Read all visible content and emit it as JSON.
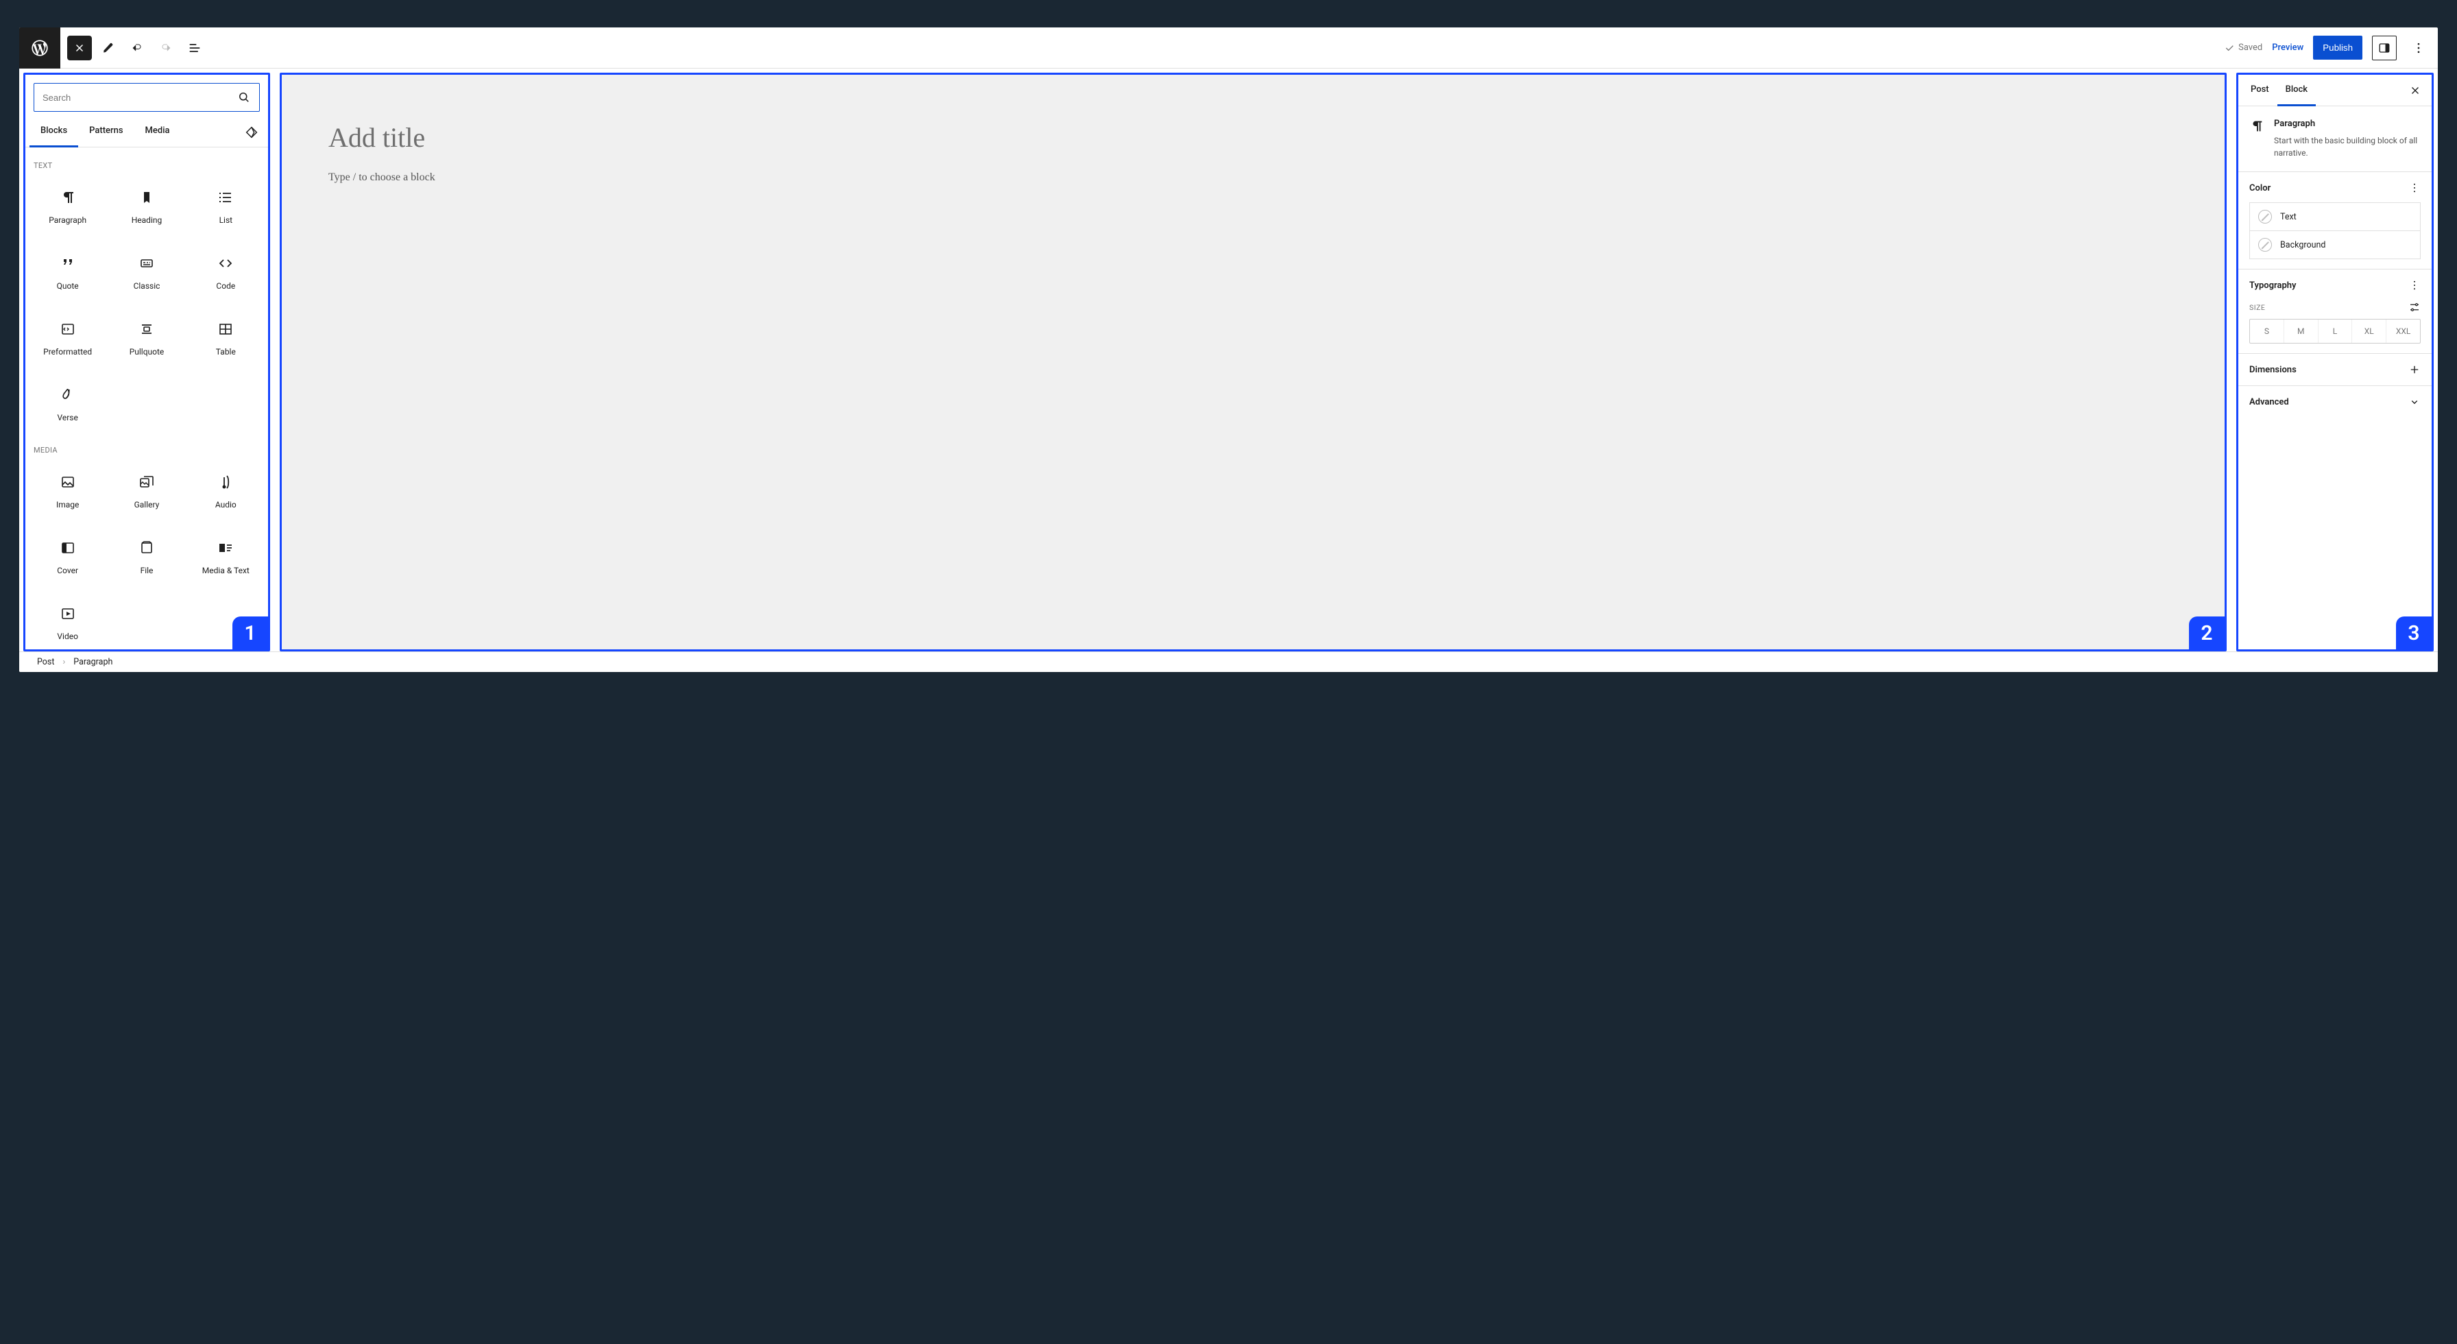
{
  "topbar": {
    "saved": "Saved",
    "preview": "Preview",
    "publish": "Publish"
  },
  "inserter": {
    "search_placeholder": "Search",
    "tabs": {
      "blocks": "Blocks",
      "patterns": "Patterns",
      "media": "Media"
    },
    "categories": [
      {
        "title": "TEXT",
        "blocks": [
          {
            "label": "Paragraph",
            "icon": "paragraph"
          },
          {
            "label": "Heading",
            "icon": "heading"
          },
          {
            "label": "List",
            "icon": "list"
          },
          {
            "label": "Quote",
            "icon": "quote"
          },
          {
            "label": "Classic",
            "icon": "classic"
          },
          {
            "label": "Code",
            "icon": "code"
          },
          {
            "label": "Preformatted",
            "icon": "preformatted"
          },
          {
            "label": "Pullquote",
            "icon": "pullquote"
          },
          {
            "label": "Table",
            "icon": "table"
          },
          {
            "label": "Verse",
            "icon": "verse"
          }
        ]
      },
      {
        "title": "MEDIA",
        "blocks": [
          {
            "label": "Image",
            "icon": "image"
          },
          {
            "label": "Gallery",
            "icon": "gallery"
          },
          {
            "label": "Audio",
            "icon": "audio"
          },
          {
            "label": "Cover",
            "icon": "cover"
          },
          {
            "label": "File",
            "icon": "file"
          },
          {
            "label": "Media & Text",
            "icon": "mediatext"
          },
          {
            "label": "Video",
            "icon": "video"
          }
        ]
      }
    ]
  },
  "canvas": {
    "title_placeholder": "Add title",
    "body_placeholder": "Type / to choose a block"
  },
  "settings": {
    "tabs": {
      "post": "Post",
      "block": "Block"
    },
    "block_title": "Paragraph",
    "block_desc": "Start with the basic building block of all narrative.",
    "color": {
      "title": "Color",
      "text": "Text",
      "background": "Background"
    },
    "typography": {
      "title": "Typography",
      "size_label": "SIZE",
      "sizes": [
        "S",
        "M",
        "L",
        "XL",
        "XXL"
      ]
    },
    "dimensions": "Dimensions",
    "advanced": "Advanced"
  },
  "breadcrumb": {
    "post": "Post",
    "current": "Paragraph"
  },
  "annotations": {
    "pane1": "1",
    "pane2": "2",
    "pane3": "3"
  }
}
